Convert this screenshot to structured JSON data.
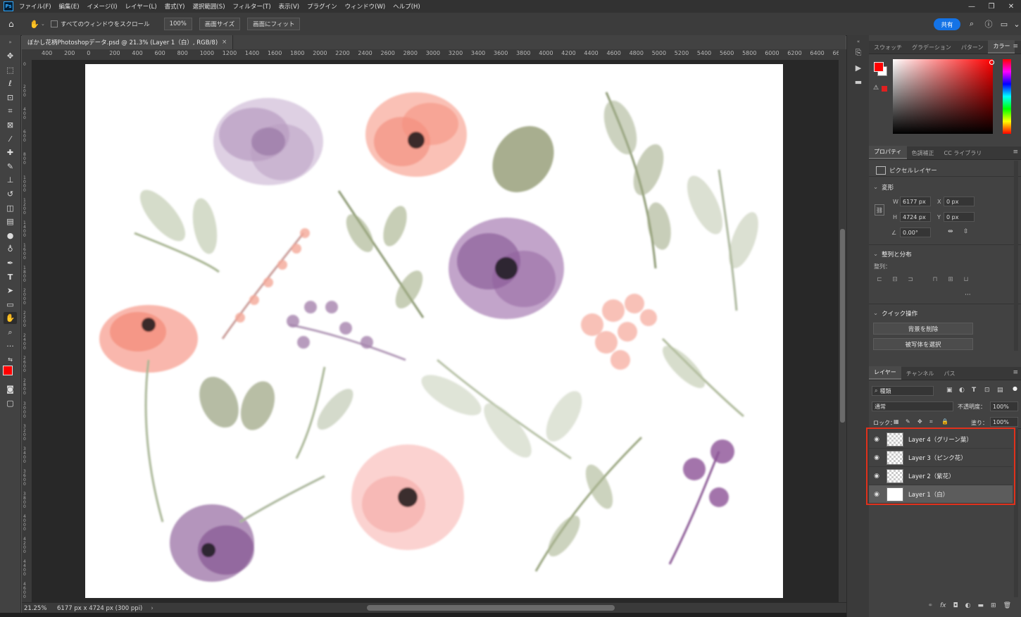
{
  "menu": [
    "ファイル(F)",
    "編集(E)",
    "イメージ(I)",
    "レイヤー(L)",
    "書式(Y)",
    "選択範囲(S)",
    "フィルター(T)",
    "表示(V)",
    "プラグイン",
    "ウィンドウ(W)",
    "ヘルプ(H)"
  ],
  "app_logo": "Ps",
  "options": {
    "scroll_all_label": "すべてのウィンドウをスクロール",
    "zoom_value": "100%",
    "screen_size_label": "画面サイズ",
    "fit_screen_label": "画面にフィット",
    "share_label": "共有"
  },
  "document": {
    "tab_title": "ぼかし花柄Photoshopデータ.psd @ 21.3% (Layer 1（白）, RGB/8)"
  },
  "ruler": {
    "top_ticks": [
      "400",
      "200",
      "0",
      "200",
      "400",
      "600",
      "800",
      "1000",
      "1200",
      "1400",
      "1600",
      "1800",
      "2000",
      "2200",
      "2400",
      "2600",
      "2800",
      "3000",
      "3200",
      "3400",
      "3600",
      "3800",
      "4000",
      "4200",
      "4400",
      "4600",
      "4800",
      "5000",
      "5200",
      "5400",
      "5600",
      "5800",
      "6000",
      "6200",
      "6400",
      "66"
    ],
    "left_ticks": [
      "0",
      "200",
      "400",
      "600",
      "800",
      "1000",
      "1200",
      "1400",
      "1600",
      "1800",
      "2000",
      "2200",
      "2400",
      "2600",
      "2800",
      "3000",
      "3200",
      "3400",
      "3600",
      "3800",
      "4000",
      "4200",
      "4400",
      "4600"
    ]
  },
  "status": {
    "zoom": "21.25%",
    "doc_size": "6177 px x 4724 px (300 ppi)"
  },
  "color_panel": {
    "tabs": [
      "スウォッチ",
      "グラデーション",
      "パターン",
      "カラー"
    ],
    "active_tab": "カラー",
    "foreground_color": "#ff0000",
    "background_color": "#ffffff"
  },
  "properties_panel": {
    "tabs": [
      "プロパティ",
      "色調補正",
      "CC ライブラリ"
    ],
    "active_tab": "プロパティ",
    "layer_kind": "ピクセルレイヤー",
    "transform": {
      "heading": "変形",
      "w_label": "W",
      "w_value": "6177 px",
      "h_label": "H",
      "h_value": "4724 px",
      "x_label": "X",
      "x_value": "0 px",
      "y_label": "Y",
      "y_value": "0 px",
      "angle_value": "0.00°"
    },
    "align": {
      "heading": "整列と分布",
      "sub_label": "整列："
    },
    "quick_actions": {
      "heading": "クイック操作",
      "remove_bg": "背景を削除",
      "select_subject": "被写体を選択"
    }
  },
  "layers_panel": {
    "tabs": [
      "レイヤー",
      "チャンネル",
      "パス"
    ],
    "active_tab": "レイヤー",
    "filter_kind": "種類",
    "blend_mode": "通常",
    "opacity_label": "不透明度：",
    "opacity_value": "100%",
    "lock_label": "ロック：",
    "fill_label": "塗り：",
    "fill_value": "100%",
    "layers": [
      {
        "name": "Layer 4（グリーン葉）",
        "selected": false,
        "thumb": "transparent"
      },
      {
        "name": "Layer 3（ピンク花）",
        "selected": false,
        "thumb": "transparent"
      },
      {
        "name": "Layer 2（紫花）",
        "selected": false,
        "thumb": "transparent"
      },
      {
        "name": "Layer 1（白）",
        "selected": true,
        "thumb": "white"
      }
    ],
    "highlight_color": "#e1311c"
  }
}
